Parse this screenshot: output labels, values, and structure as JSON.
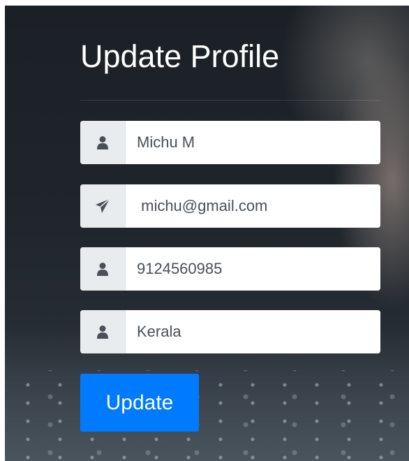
{
  "form": {
    "title": "Update Profile",
    "fields": [
      {
        "name": "name",
        "value": "Michu M",
        "icon": "user-icon"
      },
      {
        "name": "email",
        "value": " michu@gmail.com",
        "icon": "paper-plane-icon"
      },
      {
        "name": "phone",
        "value": "9124560985",
        "icon": "user-icon"
      },
      {
        "name": "location",
        "value": "Kerala",
        "icon": "user-icon"
      }
    ],
    "update_label": "Update"
  },
  "colors": {
    "primary": "#007bff",
    "addon_bg": "#e9ecef",
    "icon": "#495057",
    "title": "#ffffff"
  }
}
